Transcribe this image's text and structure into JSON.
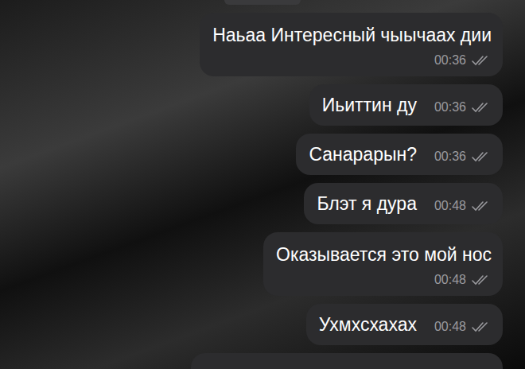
{
  "messages": [
    {
      "text": "Наьаа Интересный чыычаах дии",
      "time": "00:36",
      "read": true,
      "kind": "stacked"
    },
    {
      "text": "Иьиттин ду",
      "time": "00:36",
      "read": true,
      "kind": "inline"
    },
    {
      "text": "Санарарын?",
      "time": "00:36",
      "read": true,
      "kind": "inline"
    },
    {
      "text": "Блэт я дура",
      "time": "00:48",
      "read": true,
      "kind": "inline"
    },
    {
      "text": "Оказывается это мой нос",
      "time": "00:48",
      "read": true,
      "kind": "stacked"
    },
    {
      "text": "Ухмхсхахах",
      "time": "00:48",
      "read": true,
      "kind": "inline"
    }
  ]
}
